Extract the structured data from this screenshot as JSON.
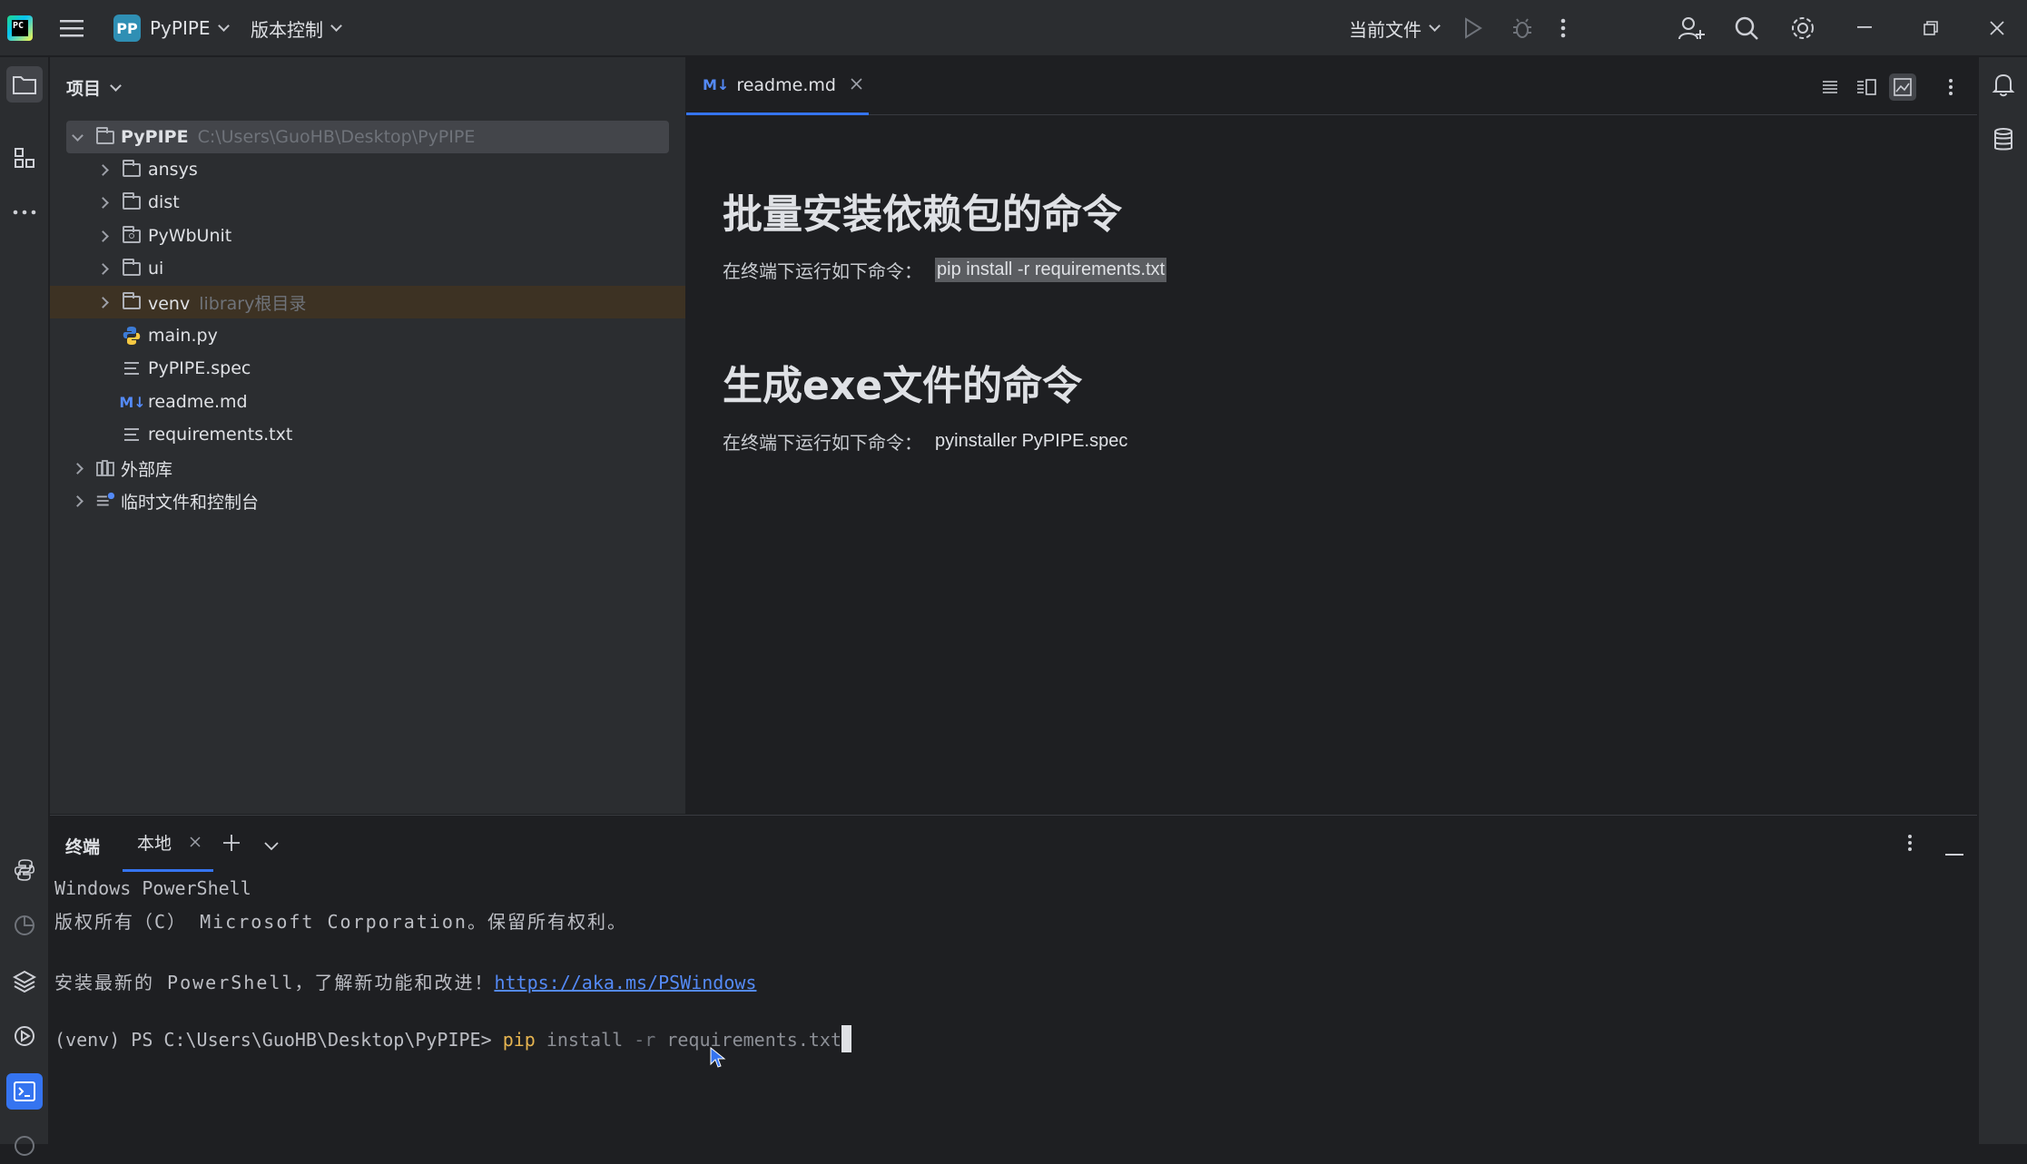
{
  "titlebar": {
    "project_badge": "PP",
    "project_name": "PyPIPE",
    "vcs_label": "版本控制",
    "run_config": "当前文件"
  },
  "project_panel": {
    "header": "项目",
    "root": {
      "name": "PyPIPE",
      "path": "C:\\Users\\GuoHB\\Desktop\\PyPIPE"
    },
    "items": [
      {
        "name": "ansys",
        "kind": "folder"
      },
      {
        "name": "dist",
        "kind": "folder"
      },
      {
        "name": "PyWbUnit",
        "kind": "package"
      },
      {
        "name": "ui",
        "kind": "folder"
      },
      {
        "name": "venv",
        "kind": "folder",
        "hint": "library根目录"
      },
      {
        "name": "main.py",
        "kind": "python"
      },
      {
        "name": "PyPIPE.spec",
        "kind": "text"
      },
      {
        "name": "readme.md",
        "kind": "markdown"
      },
      {
        "name": "requirements.txt",
        "kind": "text"
      }
    ],
    "external_libs": "外部库",
    "scratches": "临时文件和控制台"
  },
  "editor": {
    "tab_icon": "M↓",
    "tab_label": "readme.md",
    "heading1": "批量安装依赖包的命令",
    "para1_prefix": "在终端下运行如下命令：",
    "para1_code": "pip install -r requirements.txt",
    "heading2": "生成exe文件的命令",
    "para2_prefix": "在终端下运行如下命令：",
    "para2_code": "pyinstaller PyPIPE.spec"
  },
  "terminal": {
    "title": "终端",
    "tab_label": "本地",
    "line1": "Windows PowerShell",
    "line2": "版权所有（C） Microsoft Corporation。保留所有权利。",
    "line3_prefix": "安装最新的 PowerShell，了解新功能和改进！",
    "line3_link": "https://aka.ms/PSWindows",
    "prompt": "(venv) PS C:\\Users\\GuoHB\\Desktop\\PyPIPE> ",
    "cmd_pip": "pip",
    "cmd_install": " install ",
    "cmd_flag": "-r",
    "cmd_file": " requirements.txt"
  },
  "colors": {
    "accent": "#3574f0",
    "background": "#1e1f22",
    "panel": "#2b2d30"
  }
}
